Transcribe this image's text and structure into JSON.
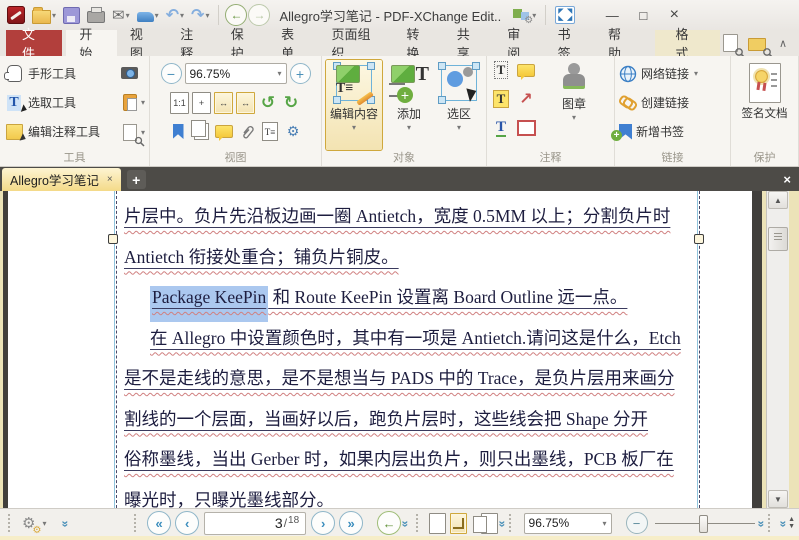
{
  "colors": {
    "accent_red": "#b23f3c",
    "active_highlight": "#f3e3b2",
    "active_border": "#cfa83d",
    "selection_blue": "#abc8ef",
    "doc_tab_yellow": "#f4da88"
  },
  "icons": {
    "caret": "▾",
    "chevron_up": "∧",
    "undo": "↶",
    "redo": "↷",
    "back": "←",
    "forward": "→",
    "minimize": "—",
    "maximize": "□",
    "close": "×",
    "rotate_left": "↺",
    "rotate_right": "↻",
    "zoom_out": "−",
    "zoom_in": "+",
    "nav_first": "«",
    "nav_prev": "‹",
    "nav_next": "›",
    "nav_last": "»",
    "chevron_double": "»",
    "plus": "+",
    "tab_close": "×",
    "gear": "⚙",
    "envelope": "✉",
    "fit_width": "↔",
    "arrow_ne": "↗",
    "up": "▲",
    "down": "▼"
  },
  "titlebar": {
    "title": "Allegro学习笔记 - PDF-XChange Edit.."
  },
  "ribbon_tabs": [
    {
      "label": "文件",
      "style": "file"
    },
    {
      "label": "开始",
      "style": "active"
    },
    {
      "label": "视图"
    },
    {
      "label": "注释"
    },
    {
      "label": "保护"
    },
    {
      "label": "表单"
    },
    {
      "label": "页面组织"
    },
    {
      "label": "转换"
    },
    {
      "label": "共享"
    },
    {
      "label": "审阅"
    },
    {
      "label": "书签"
    },
    {
      "label": "帮助"
    },
    {
      "label": "格式",
      "style": "format"
    }
  ],
  "ribbon": {
    "tools": {
      "label": "工具",
      "hand": "手形工具",
      "select": "选取工具",
      "edit_annot": "编辑注释工具"
    },
    "view": {
      "label": "视图",
      "zoom_value": "96.75%",
      "actual_size": "1:1"
    },
    "object": {
      "label": "对象",
      "edit_content": "编辑内容",
      "add": "添加",
      "selection": "选区"
    },
    "comment": {
      "label": "注释",
      "stamp": "图章"
    },
    "links": {
      "label": "链接",
      "web_link": "网络链接",
      "create_link": "创建链接",
      "add_bookmark": "新增书签"
    },
    "protect": {
      "label": "保护",
      "sign": "签名文档"
    }
  },
  "doc_tabs": {
    "active_title": "Allegro学习笔记"
  },
  "document": {
    "lines": [
      {
        "indent": false,
        "segments": [
          {
            "t": "片层中。负片先沿板边画一圈 Antietch，宽度 0.5MM 以上；分割负片时"
          }
        ]
      },
      {
        "indent": false,
        "segments": [
          {
            "t": "Antietch 衔接处重合；铺负片铜皮。"
          }
        ]
      },
      {
        "indent": true,
        "segments": [
          {
            "t": "Package KeePin",
            "sel": true
          },
          {
            "t": " 和 Route KeePin 设置离 Board Outline 远一点。"
          }
        ]
      },
      {
        "indent": true,
        "segments": [
          {
            "t": "在 Allegro 中设置颜色时，其中有一项是 Antietch.请问这是什么，Etch"
          }
        ]
      },
      {
        "indent": false,
        "segments": [
          {
            "t": "是不是走线的意思，是不是想当与 PADS 中的 Trace，是负片层用来画分"
          }
        ]
      },
      {
        "indent": false,
        "segments": [
          {
            "t": "割线的一个层面，当画好以后，跑负片层时，这些线会把 Shape 分开"
          }
        ]
      },
      {
        "indent": false,
        "segments": [
          {
            "t": "俗称墨线，当出 Gerber 时，如果内层出负片，则只出墨线，PCB 板厂在"
          }
        ]
      },
      {
        "indent": false,
        "segments": [
          {
            "t": "曝光时，只曝光墨线部分。"
          }
        ]
      }
    ]
  },
  "statusbar": {
    "page_current": "3",
    "page_sep": "/",
    "page_total": "18",
    "zoom_value": "96.75%"
  }
}
